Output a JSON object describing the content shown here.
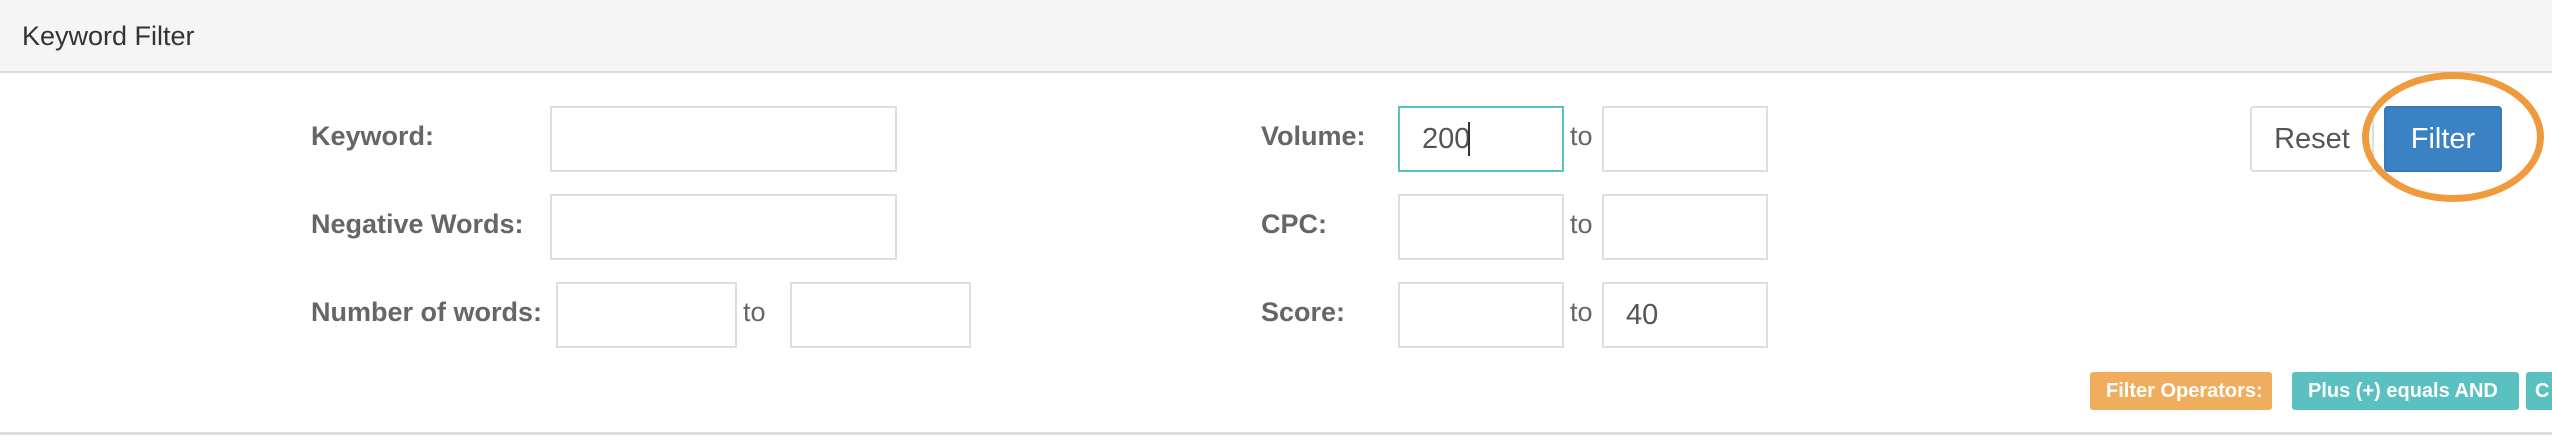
{
  "panel": {
    "title": "Keyword Filter"
  },
  "left_column": {
    "keyword_label": "Keyword:",
    "keyword_value": "",
    "negative_words_label": "Negative Words:",
    "negative_words_value": "",
    "number_of_words_label": "Number of words:",
    "number_of_words_min": "",
    "number_of_words_max": "",
    "to_label": "to"
  },
  "right_column": {
    "volume_label": "Volume:",
    "volume_min": "200",
    "volume_max": "",
    "cpc_label": "CPC:",
    "cpc_min": "",
    "cpc_max": "",
    "score_label": "Score:",
    "score_min": "",
    "score_max": "40",
    "to_label": "to"
  },
  "actions": {
    "reset_label": "Reset",
    "filter_label": "Filter"
  },
  "operators": {
    "title": "Filter Operators:",
    "plus_rule": "Plus (+) equals AND",
    "next_rule_partial": "C"
  },
  "colors": {
    "primary": "#3a82c4",
    "highlight": "#ef9a3c",
    "badge_orange": "#f0ad5e",
    "badge_teal": "#5bc0c0",
    "focus_border": "#5bc0c0"
  }
}
